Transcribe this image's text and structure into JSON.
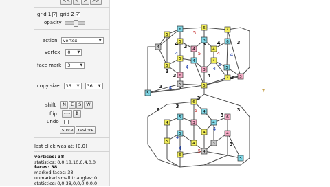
{
  "nav": {
    "prev_prev": "<<",
    "prev": "<",
    "next": ">",
    "next_next": ">>"
  },
  "grid1": {
    "label": "grid 1",
    "checked": "✓"
  },
  "grid2": {
    "label": "grid 2",
    "checked": "✓"
  },
  "opacity": {
    "label": "opacity",
    "level": 0.45
  },
  "action": {
    "label": "action",
    "value": "vertex"
  },
  "vertex": {
    "label": "vertex",
    "value": "0"
  },
  "face_mark": {
    "label": "face mark",
    "value": "3"
  },
  "copy_size": {
    "label": "copy size",
    "value1": "36",
    "value2": "36"
  },
  "shift": {
    "label": "shift",
    "buttons": [
      "N",
      "E",
      "S",
      "W"
    ]
  },
  "flip": {
    "label": "flip",
    "buttons": [
      "⟷",
      "↕"
    ]
  },
  "undo": {
    "label": "undo"
  },
  "store": {
    "store": "store",
    "restore": "restore"
  },
  "last_click": "last click was at: (0,0)",
  "info": {
    "vertices": "vertices: 38",
    "statistics": "statistics: 0,0,18,10,6,4,0,0",
    "faces": "faces: 38",
    "marked_faces": "marked faces: 38",
    "unmarked": "unmarked small triangles: 0",
    "statistics2": "statistics: 0,0,38,0,0,0,0,0,0"
  },
  "canvas": {
    "side_label": "7",
    "face_labels": [
      "5",
      "4",
      "3",
      "3",
      "3",
      "4",
      "4",
      "5",
      "4",
      "4",
      "4",
      "4",
      "6",
      "3",
      "3",
      "4",
      "3",
      "3",
      "3",
      "3",
      "4",
      "6",
      "3",
      "3",
      "3",
      "3",
      "5",
      "4",
      "5",
      "4",
      "4",
      "3"
    ],
    "vertex_numbers": [
      "5",
      "6",
      "6",
      "4",
      "4",
      "5",
      "4",
      "3",
      "4",
      "6",
      "5",
      "5",
      "4",
      "3",
      "4",
      "5",
      "6",
      "5",
      "4",
      "3",
      "5",
      "5",
      "6",
      "4",
      "4",
      "5",
      "3",
      "4",
      "4",
      "6",
      "5",
      "5",
      "4",
      "3",
      "4",
      "5",
      "6",
      "4"
    ]
  },
  "colors": {
    "yellow": "#f2ee5a",
    "cyan": "#7fd7e6",
    "pink": "#f4a9c4",
    "gray": "#c8c8c8",
    "edge": "#4b4b4b",
    "red": "#c02020",
    "blue": "#1e3fae"
  }
}
